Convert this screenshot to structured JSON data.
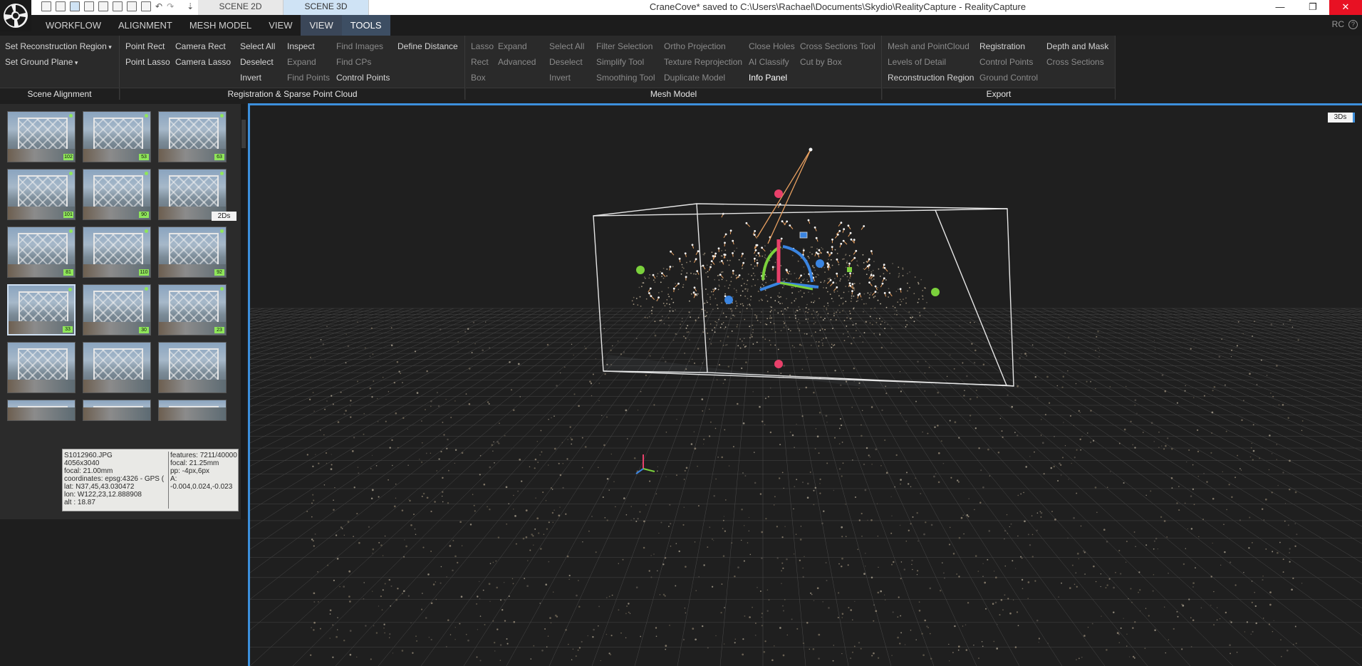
{
  "titlebar": {
    "window_title": "CraneCove* saved to C:\\Users\\Rachael\\Documents\\Skydio\\RealityCapture - RealityCapture",
    "scene_tabs": [
      "SCENE 2D",
      "SCENE 3D"
    ],
    "controls": {
      "minimize": "—",
      "restore": "❐",
      "close": "✕"
    }
  },
  "menu": {
    "items": [
      "WORKFLOW",
      "ALIGNMENT",
      "MESH MODEL",
      "VIEW",
      "VIEW",
      "TOOLS"
    ],
    "rc": "RC",
    "help": "?"
  },
  "ribbon": {
    "scene_alignment": {
      "title": "Scene Alignment",
      "buttons": [
        "Set Reconstruction Region",
        "Set Ground Plane"
      ]
    },
    "registration": {
      "title": "Registration & Sparse Point Cloud",
      "col1": [
        "Point Rect",
        "Point Lasso"
      ],
      "col2": [
        "Camera Rect",
        "Camera Lasso"
      ],
      "col3": [
        "Select All",
        "Deselect",
        "Invert"
      ],
      "col4": [
        "Inspect",
        "Expand",
        "Find Points"
      ],
      "col5": [
        "Find Images",
        "Find CPs",
        "Control Points"
      ],
      "col6": [
        "Define Distance"
      ]
    },
    "mesh_model": {
      "title": "Mesh Model",
      "col1": [
        "Lasso",
        "Rect",
        "Box"
      ],
      "col2": [
        "Expand",
        "Advanced"
      ],
      "col3": [
        "Select All",
        "Deselect",
        "Invert"
      ],
      "col4": [
        "Filter Selection",
        "Simplify Tool",
        "Smoothing Tool"
      ],
      "col5": [
        "Ortho Projection",
        "Texture Reprojection",
        "Duplicate Model"
      ],
      "col6": [
        "Close Holes",
        "AI Classify",
        "Info Panel"
      ],
      "col7": [
        "Cross Sections Tool",
        "Cut by Box"
      ]
    },
    "export": {
      "title": "Export",
      "col1": [
        "Mesh and PointCloud",
        "Levels of Detail",
        "Reconstruction Region"
      ],
      "col2": [
        "Registration",
        "Control Points",
        "Ground Control"
      ],
      "col3": [
        "Depth and Mask",
        "Cross Sections"
      ]
    }
  },
  "left_panel": {
    "badge": "2Ds",
    "thumbnails": [
      {
        "label": "102"
      },
      {
        "label": "53"
      },
      {
        "label": "63"
      },
      {
        "label": "101"
      },
      {
        "label": "90"
      },
      {
        "label": "83"
      },
      {
        "label": "81"
      },
      {
        "label": "110"
      },
      {
        "label": "92"
      },
      {
        "label": "33"
      },
      {
        "label": "30"
      },
      {
        "label": "23"
      },
      {
        "label": ""
      }
    ],
    "tooltip": {
      "filename": "S1012960.JPG",
      "resolution": "4056x3040",
      "focal": "focal: 21.00mm",
      "coordinates": "coordinates: epsg:4326 - GPS (",
      "lat": "lat: N37,45,43.030472",
      "lon": "lon: W122,23,12.888908",
      "alt": "alt : 18.87",
      "features": "features: 7211/40000",
      "focal2": "focal: 21.25mm",
      "pp": "pp: -4px,6px",
      "distortion": "A: -0.004,0.024,-0.023"
    }
  },
  "viewport": {
    "badge": "3Ds",
    "colors": {
      "accent": "#3c8fdc",
      "gizmo_red": "#e8406a",
      "gizmo_green": "#7bd13c",
      "gizmo_blue": "#3a84e0",
      "camera_orange": "#e8a060"
    }
  }
}
